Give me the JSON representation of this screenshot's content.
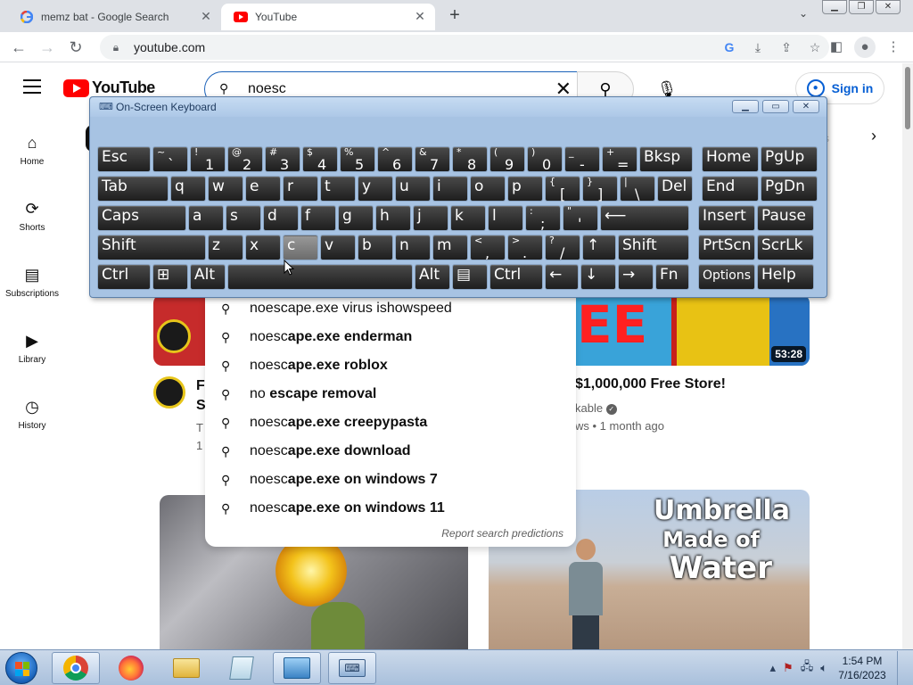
{
  "browser": {
    "tabs": [
      {
        "title": "memz bat - Google Search",
        "favicon": "google-icon"
      },
      {
        "title": "YouTube",
        "favicon": "youtube-icon"
      }
    ],
    "url": "youtube.com"
  },
  "youtube": {
    "logo_text": "YouTube",
    "search_query": "noesc",
    "sign_in": "Sign in",
    "sidebar": [
      {
        "label": "Home",
        "icon": "home-icon"
      },
      {
        "label": "Shorts",
        "icon": "shorts-icon"
      },
      {
        "label": "Subscriptions",
        "icon": "subscriptions-icon"
      },
      {
        "label": "Library",
        "icon": "library-icon"
      },
      {
        "label": "History",
        "icon": "history-icon"
      }
    ],
    "suggestions": [
      {
        "bold": "noescape.exe virus ishowspeed",
        "prefix": ""
      },
      {
        "prefix": "noesc",
        "bold": "ape.exe enderman"
      },
      {
        "prefix": "noesc",
        "bold": "ape.exe roblox"
      },
      {
        "prefix": "no",
        "bold": " escape removal"
      },
      {
        "prefix": "noesc",
        "bold": "ape.exe creepypasta"
      },
      {
        "prefix": "noesc",
        "bold": "ape.exe download"
      },
      {
        "prefix": "noesc",
        "bold": "ape.exe on windows 7"
      },
      {
        "prefix": "noesc",
        "bold": "ape.exe on windows 11"
      }
    ],
    "report": "Report search predictions",
    "videos": {
      "left_title": "F\nS",
      "left_meta": "T\n1",
      "right_duration": "53:28",
      "right_title": "$1,000,000 Free Store!",
      "right_channel": "kable",
      "right_meta": "ws • 1 month ago",
      "umbrella_l1": "Umbrella",
      "umbrella_l2": "Made of",
      "umbrella_l3": "Water"
    }
  },
  "osk": {
    "title": "On-Screen Keyboard",
    "rows": [
      [
        {
          "a": "Esc",
          "w": 60
        },
        {
          "t": "~",
          "b": "`",
          "w": 40
        },
        {
          "t": "!",
          "b": "1",
          "w": 40
        },
        {
          "t": "@",
          "b": "2",
          "w": 40
        },
        {
          "t": "#",
          "b": "3",
          "w": 40
        },
        {
          "t": "$",
          "b": "4",
          "w": 40
        },
        {
          "t": "%",
          "b": "5",
          "w": 40
        },
        {
          "t": "^",
          "b": "6",
          "w": 40
        },
        {
          "t": "&",
          "b": "7",
          "w": 40
        },
        {
          "t": "*",
          "b": "8",
          "w": 40
        },
        {
          "t": "(",
          "b": "9",
          "w": 40
        },
        {
          "t": ")",
          "b": "0",
          "w": 40
        },
        {
          "t": "_",
          "b": "-",
          "w": 40
        },
        {
          "t": "+",
          "b": "=",
          "w": 40
        },
        {
          "a": "Bksp",
          "w": 60
        },
        {
          "a": "Home",
          "w": 64,
          "gap": 8
        },
        {
          "a": "PgUp",
          "w": 64
        }
      ],
      [
        {
          "a": "Tab",
          "w": 80
        },
        {
          "a": "q",
          "w": 40
        },
        {
          "a": "w",
          "w": 40
        },
        {
          "a": "e",
          "w": 40
        },
        {
          "a": "r",
          "w": 40
        },
        {
          "a": "t",
          "w": 40
        },
        {
          "a": "y",
          "w": 40
        },
        {
          "a": "u",
          "w": 40
        },
        {
          "a": "i",
          "w": 40
        },
        {
          "a": "o",
          "w": 40
        },
        {
          "a": "p",
          "w": 40
        },
        {
          "t": "{",
          "b": "[",
          "w": 40
        },
        {
          "t": "}",
          "b": "]",
          "w": 40
        },
        {
          "t": "|",
          "b": "\\",
          "w": 40
        },
        {
          "a": "Del",
          "w": 40
        },
        {
          "a": "End",
          "w": 64,
          "gap": 8
        },
        {
          "a": "PgDn",
          "w": 64
        }
      ],
      [
        {
          "a": "Caps",
          "w": 100
        },
        {
          "a": "a",
          "w": 40
        },
        {
          "a": "s",
          "w": 40
        },
        {
          "a": "d",
          "w": 40
        },
        {
          "a": "f",
          "w": 40
        },
        {
          "a": "g",
          "w": 40
        },
        {
          "a": "h",
          "w": 40
        },
        {
          "a": "j",
          "w": 40
        },
        {
          "a": "k",
          "w": 40
        },
        {
          "a": "l",
          "w": 40
        },
        {
          "t": ":",
          "b": ";",
          "w": 40
        },
        {
          "t": "\"",
          "b": "'",
          "w": 40
        },
        {
          "a": "⟵",
          "w": 100
        },
        {
          "a": "Insert",
          "w": 64,
          "gap": 8
        },
        {
          "a": "Pause",
          "w": 64
        }
      ],
      [
        {
          "a": "Shift",
          "w": 122
        },
        {
          "a": "z",
          "w": 40
        },
        {
          "a": "x",
          "w": 40
        },
        {
          "a": "c",
          "w": 40,
          "pressed": true
        },
        {
          "a": "v",
          "w": 40
        },
        {
          "a": "b",
          "w": 40
        },
        {
          "a": "n",
          "w": 40
        },
        {
          "a": "m",
          "w": 40
        },
        {
          "t": "<",
          "b": ",",
          "w": 40
        },
        {
          "t": ">",
          "b": ".",
          "w": 40
        },
        {
          "t": "?",
          "b": "/",
          "w": 40
        },
        {
          "a": "↑",
          "w": 38
        },
        {
          "a": "Shift",
          "w": 80
        },
        {
          "a": "PrtScn",
          "w": 64,
          "gap": 8
        },
        {
          "a": "ScrLk",
          "w": 64
        }
      ],
      [
        {
          "a": "Ctrl",
          "w": 60
        },
        {
          "a": "⊞",
          "w": 40
        },
        {
          "a": "Alt",
          "w": 40
        },
        {
          "a": "",
          "w": 208
        },
        {
          "a": "Alt",
          "w": 40
        },
        {
          "a": "▤",
          "w": 40
        },
        {
          "a": "Ctrl",
          "w": 60
        },
        {
          "a": "←",
          "w": 38
        },
        {
          "a": "↓",
          "w": 40
        },
        {
          "a": "→",
          "w": 40
        },
        {
          "a": "Fn",
          "w": 38
        },
        {
          "a": "Options",
          "w": 64,
          "gap": 8,
          "small": true
        },
        {
          "a": "Help",
          "w": 64
        }
      ]
    ]
  },
  "taskbar": {
    "time": "1:54 PM",
    "date": "7/16/2023",
    "apps": [
      "chrome-icon",
      "firefox-icon",
      "explorer-icon",
      "notepad-icon",
      "control-panel-icon",
      "keyboard-icon"
    ]
  },
  "colors": {
    "yt_red": "#ff0000",
    "link_blue": "#065fd4",
    "key_dark": "#1e1e1e",
    "osk_frame": "#a7c3e3"
  }
}
